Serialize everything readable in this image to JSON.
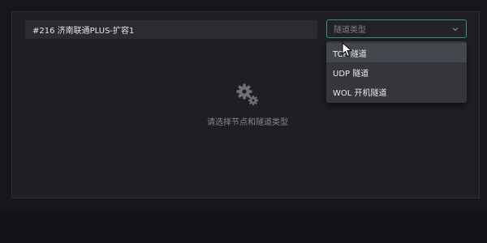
{
  "node": {
    "value": "#216 济南联通PLUS-扩容1"
  },
  "tunnel_select": {
    "placeholder": "隧道类型",
    "icon": "chevron-down-icon",
    "options": [
      {
        "label": "TCP 隧道",
        "hovered": true
      },
      {
        "label": "UDP 隧道",
        "hovered": false
      },
      {
        "label": "WOL 开机隧道",
        "hovered": false
      }
    ]
  },
  "empty_state": {
    "icon": "gears-icon",
    "message": "请选择节点和隧道类型"
  },
  "colors": {
    "background": "#17171b",
    "panel": "#1e1e23",
    "accent_border": "#3f8f72",
    "dropdown_bg": "#34363c",
    "dropdown_hover": "#45474e"
  }
}
